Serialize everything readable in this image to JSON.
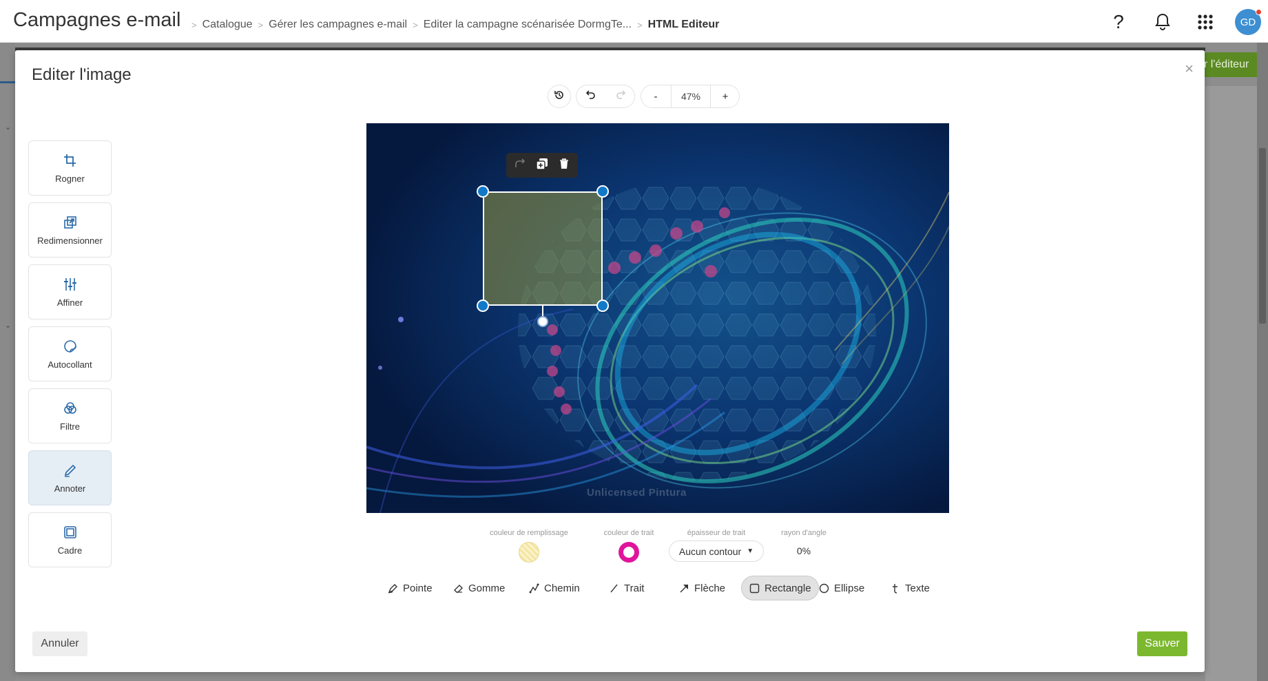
{
  "header": {
    "app_title": "Campagnes e-mail",
    "breadcrumb": [
      "Catalogue",
      "Gérer les campagnes e-mail",
      "Editer la campagne scénarisée DormgTe...",
      "HTML Editeur"
    ],
    "user_initials": "GD"
  },
  "background": {
    "editor_button_label": "r l'éditeur"
  },
  "modal": {
    "title": "Editer l'image",
    "close_symbol": "×",
    "tools": [
      {
        "label": "Rogner",
        "icon": "crop-icon"
      },
      {
        "label": "Redimensionner",
        "icon": "resize-icon"
      },
      {
        "label": "Affiner",
        "icon": "sliders-icon"
      },
      {
        "label": "Autocollant",
        "icon": "sticker-icon"
      },
      {
        "label": "Filtre",
        "icon": "filter-icon"
      },
      {
        "label": "Annoter",
        "icon": "pencil-icon",
        "active": true
      },
      {
        "label": "Cadre",
        "icon": "frame-icon"
      }
    ],
    "toolbar": {
      "zoom_out": "-",
      "zoom_value": "47%",
      "zoom_in": "+"
    },
    "canvas": {
      "watermark": "Unlicensed Pintura"
    },
    "shape_options": {
      "fill_label": "couleur de remplissage",
      "stroke_color_label": "couleur de trait",
      "stroke_width_label": "épaisseur de trait",
      "stroke_width_value": "Aucun contour",
      "corner_radius_label": "rayon d'angle",
      "corner_radius_value": "0%",
      "fill_color": "#f3e6a3",
      "stroke_color": "#e0159b"
    },
    "draw_tools": [
      {
        "label": "Pointe",
        "icon": "sharpie-icon"
      },
      {
        "label": "Gomme",
        "icon": "eraser-icon"
      },
      {
        "label": "Chemin",
        "icon": "path-icon"
      },
      {
        "label": "Trait",
        "icon": "line-icon"
      },
      {
        "label": "Flèche",
        "icon": "arrow-icon"
      },
      {
        "label": "Rectangle",
        "icon": "rectangle-icon",
        "active": true
      },
      {
        "label": "Ellipse",
        "icon": "ellipse-icon"
      },
      {
        "label": "Texte",
        "icon": "text-icon"
      }
    ],
    "cancel_label": "Annuler",
    "save_label": "Sauver"
  },
  "colors": {
    "accent_green": "#7cb82f",
    "handle_blue": "#1279c9",
    "avatar_blue": "#3d8fd1"
  }
}
